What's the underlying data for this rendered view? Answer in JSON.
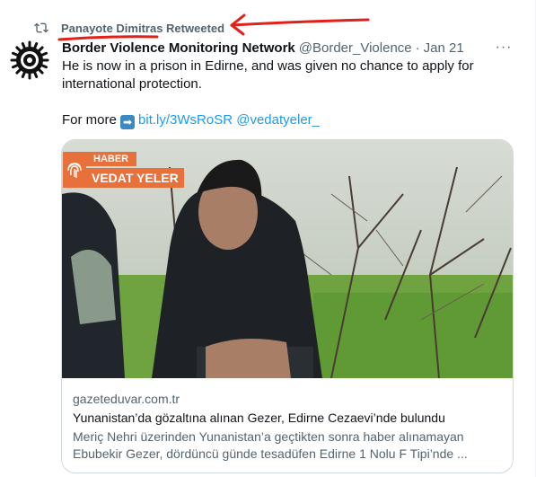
{
  "retweet": {
    "label": "Panayote Dimitras Retweeted"
  },
  "author": {
    "name": "Border Violence Monitoring Network",
    "handle": "@Border_Violence",
    "separator": "·",
    "date": "Jan 21"
  },
  "more_label": "···",
  "tweet": {
    "line1": "He is now in a prison in Edirne, and was given no chance to apply for international protection.",
    "more_prefix": "For more",
    "arrow_emoji": "➡",
    "link": "bit.ly/3WsRoSR",
    "mention": "@vedatyeler_"
  },
  "card": {
    "badge_top": "HABER",
    "badge_bottom": "VEDAT YELER",
    "domain": "gazeteduvar.com.tr",
    "title": "Yunanistan’da gözaltına alınan Gezer, Edirne Cezaevi’nde bulundu",
    "desc_line1": "Meriç Nehri üzerinden Yunanistan’a geçtikten sonra haber alınamayan",
    "desc_line2": "Ebubekir Gezer, dördüncü günde tesadüfen Edirne 1 Nolu F Tipi’nde ..."
  },
  "colors": {
    "accent": "#1d9bf0",
    "secondary_text": "#536471",
    "annotation": "#e0201b",
    "badge": "#e8703a"
  }
}
